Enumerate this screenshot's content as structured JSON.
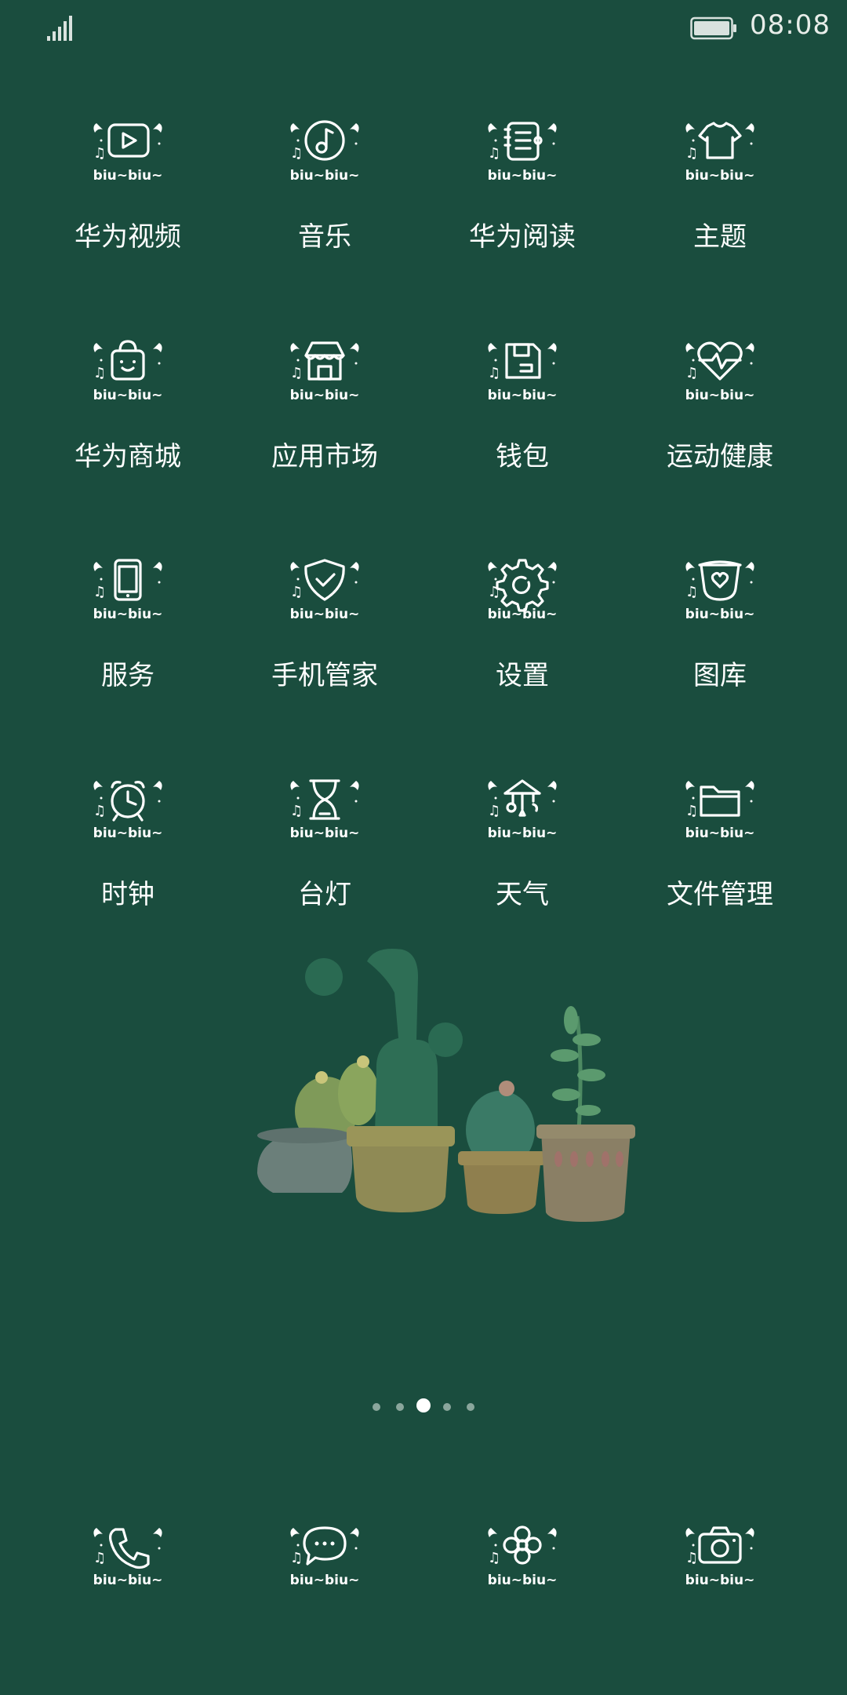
{
  "status_bar": {
    "time": "08:08",
    "signal_icon": "signal-icon",
    "battery_icon": "battery-icon"
  },
  "apps": [
    {
      "label": "华为视频",
      "icon": "video-play-icon"
    },
    {
      "label": "音乐",
      "icon": "music-note-icon"
    },
    {
      "label": "华为阅读",
      "icon": "book-icon"
    },
    {
      "label": "主题",
      "icon": "tshirt-icon"
    },
    {
      "label": "华为商城",
      "icon": "shopping-bag-icon"
    },
    {
      "label": "应用市场",
      "icon": "store-icon"
    },
    {
      "label": "钱包",
      "icon": "wallet-icon"
    },
    {
      "label": "运动健康",
      "icon": "heart-pulse-icon"
    },
    {
      "label": "服务",
      "icon": "phone-device-icon"
    },
    {
      "label": "手机管家",
      "icon": "shield-check-icon"
    },
    {
      "label": "设置",
      "icon": "gear-icon"
    },
    {
      "label": "图库",
      "icon": "gallery-heart-icon"
    },
    {
      "label": "时钟",
      "icon": "alarm-clock-icon"
    },
    {
      "label": "台灯",
      "icon": "hourglass-icon"
    },
    {
      "label": "天气",
      "icon": "weather-mobile-icon"
    },
    {
      "label": "文件管理",
      "icon": "folder-icon"
    }
  ],
  "icon_caption": "biu~biu~",
  "pager": {
    "count": 5,
    "active_index": 2
  },
  "dock": [
    {
      "icon": "phone-icon"
    },
    {
      "icon": "message-icon"
    },
    {
      "icon": "flower-icon"
    },
    {
      "icon": "camera-icon"
    }
  ],
  "wallpaper": {
    "subject": "cactus-pots-illustration"
  },
  "colors": {
    "background": "#1a4d3e",
    "icon_stroke": "#ffffff"
  }
}
